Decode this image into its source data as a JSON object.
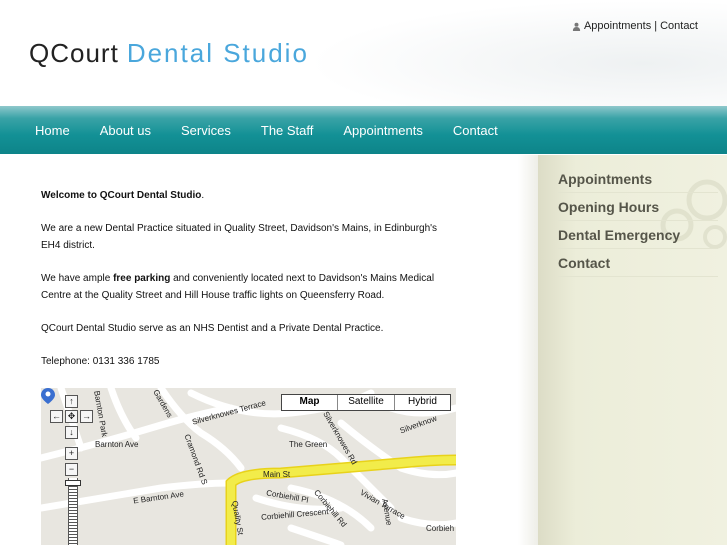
{
  "header": {
    "logo_part1": "QCourt",
    "logo_part2": "Dental Studio",
    "toplinks": {
      "appointments": "Appointments",
      "separator": "|",
      "contact": "Contact"
    }
  },
  "nav": [
    "Home",
    "About us",
    "Services",
    "The Staff",
    "Appointments",
    "Contact"
  ],
  "sidebar": [
    "Appointments",
    "Opening Hours",
    "Dental Emergency",
    "Contact"
  ],
  "content": {
    "welcome_bold": "Welcome to QCourt Dental Studio",
    "welcome_end": ".",
    "para1": "We are a new Dental Practice situated in Quality Street, Davidson's Mains, in Edinburgh's EH4 district.",
    "para2_start": "We have ample ",
    "para2_bold": "free parking",
    "para2_end": " and conveniently located next to Davidson's Mains Medical Centre at the Quality Street and Hill House traffic lights on Queensferry Road.",
    "para3": "QCourt Dental Studio serve as an NHS Dentist and a Private Dental Practice.",
    "telephone": "Telephone: 0131 336 1785"
  },
  "map": {
    "types": [
      "Map",
      "Satellite",
      "Hybrid"
    ],
    "selected_type": "Map",
    "controls": {
      "up": "↑",
      "left": "←",
      "center": "✥",
      "right": "→",
      "down": "↓",
      "zoom_in": "+",
      "zoom_out": "−"
    },
    "roads": [
      "Barnton Ave",
      "Barnton Park",
      "Gardens",
      "Silverknowes Terrace",
      "Cramond Rd S",
      "The Green",
      "Main St",
      "E Barnton Ave",
      "Corbiehill Pl",
      "Corbiehill Rd",
      "Corbiehill Crescent",
      "Vivian Terrace",
      "Quality St",
      "Silverknowes Rd",
      "Corbieh",
      "Silverknow",
      "Avenue"
    ]
  },
  "colors": {
    "accent_blue": "#4aa7dc",
    "nav_teal": "#139196",
    "sidebar_bg": "#ecedd9",
    "main_road": "#f2ec4a"
  }
}
